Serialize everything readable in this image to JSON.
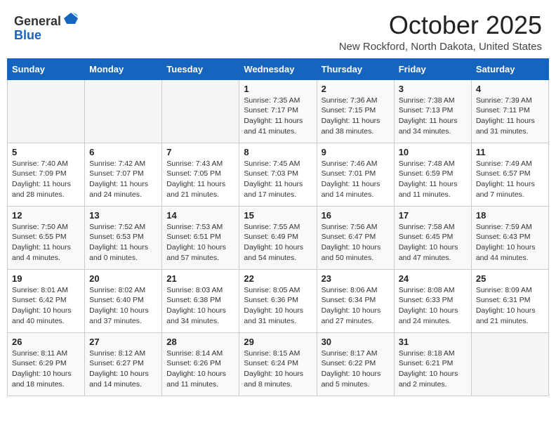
{
  "header": {
    "logo_line1": "General",
    "logo_line2": "Blue",
    "month": "October 2025",
    "location": "New Rockford, North Dakota, United States"
  },
  "weekdays": [
    "Sunday",
    "Monday",
    "Tuesday",
    "Wednesday",
    "Thursday",
    "Friday",
    "Saturday"
  ],
  "weeks": [
    [
      {
        "day": "",
        "sunrise": "",
        "sunset": "",
        "daylight": ""
      },
      {
        "day": "",
        "sunrise": "",
        "sunset": "",
        "daylight": ""
      },
      {
        "day": "",
        "sunrise": "",
        "sunset": "",
        "daylight": ""
      },
      {
        "day": "1",
        "sunrise": "Sunrise: 7:35 AM",
        "sunset": "Sunset: 7:17 PM",
        "daylight": "Daylight: 11 hours and 41 minutes."
      },
      {
        "day": "2",
        "sunrise": "Sunrise: 7:36 AM",
        "sunset": "Sunset: 7:15 PM",
        "daylight": "Daylight: 11 hours and 38 minutes."
      },
      {
        "day": "3",
        "sunrise": "Sunrise: 7:38 AM",
        "sunset": "Sunset: 7:13 PM",
        "daylight": "Daylight: 11 hours and 34 minutes."
      },
      {
        "day": "4",
        "sunrise": "Sunrise: 7:39 AM",
        "sunset": "Sunset: 7:11 PM",
        "daylight": "Daylight: 11 hours and 31 minutes."
      }
    ],
    [
      {
        "day": "5",
        "sunrise": "Sunrise: 7:40 AM",
        "sunset": "Sunset: 7:09 PM",
        "daylight": "Daylight: 11 hours and 28 minutes."
      },
      {
        "day": "6",
        "sunrise": "Sunrise: 7:42 AM",
        "sunset": "Sunset: 7:07 PM",
        "daylight": "Daylight: 11 hours and 24 minutes."
      },
      {
        "day": "7",
        "sunrise": "Sunrise: 7:43 AM",
        "sunset": "Sunset: 7:05 PM",
        "daylight": "Daylight: 11 hours and 21 minutes."
      },
      {
        "day": "8",
        "sunrise": "Sunrise: 7:45 AM",
        "sunset": "Sunset: 7:03 PM",
        "daylight": "Daylight: 11 hours and 17 minutes."
      },
      {
        "day": "9",
        "sunrise": "Sunrise: 7:46 AM",
        "sunset": "Sunset: 7:01 PM",
        "daylight": "Daylight: 11 hours and 14 minutes."
      },
      {
        "day": "10",
        "sunrise": "Sunrise: 7:48 AM",
        "sunset": "Sunset: 6:59 PM",
        "daylight": "Daylight: 11 hours and 11 minutes."
      },
      {
        "day": "11",
        "sunrise": "Sunrise: 7:49 AM",
        "sunset": "Sunset: 6:57 PM",
        "daylight": "Daylight: 11 hours and 7 minutes."
      }
    ],
    [
      {
        "day": "12",
        "sunrise": "Sunrise: 7:50 AM",
        "sunset": "Sunset: 6:55 PM",
        "daylight": "Daylight: 11 hours and 4 minutes."
      },
      {
        "day": "13",
        "sunrise": "Sunrise: 7:52 AM",
        "sunset": "Sunset: 6:53 PM",
        "daylight": "Daylight: 11 hours and 0 minutes."
      },
      {
        "day": "14",
        "sunrise": "Sunrise: 7:53 AM",
        "sunset": "Sunset: 6:51 PM",
        "daylight": "Daylight: 10 hours and 57 minutes."
      },
      {
        "day": "15",
        "sunrise": "Sunrise: 7:55 AM",
        "sunset": "Sunset: 6:49 PM",
        "daylight": "Daylight: 10 hours and 54 minutes."
      },
      {
        "day": "16",
        "sunrise": "Sunrise: 7:56 AM",
        "sunset": "Sunset: 6:47 PM",
        "daylight": "Daylight: 10 hours and 50 minutes."
      },
      {
        "day": "17",
        "sunrise": "Sunrise: 7:58 AM",
        "sunset": "Sunset: 6:45 PM",
        "daylight": "Daylight: 10 hours and 47 minutes."
      },
      {
        "day": "18",
        "sunrise": "Sunrise: 7:59 AM",
        "sunset": "Sunset: 6:43 PM",
        "daylight": "Daylight: 10 hours and 44 minutes."
      }
    ],
    [
      {
        "day": "19",
        "sunrise": "Sunrise: 8:01 AM",
        "sunset": "Sunset: 6:42 PM",
        "daylight": "Daylight: 10 hours and 40 minutes."
      },
      {
        "day": "20",
        "sunrise": "Sunrise: 8:02 AM",
        "sunset": "Sunset: 6:40 PM",
        "daylight": "Daylight: 10 hours and 37 minutes."
      },
      {
        "day": "21",
        "sunrise": "Sunrise: 8:03 AM",
        "sunset": "Sunset: 6:38 PM",
        "daylight": "Daylight: 10 hours and 34 minutes."
      },
      {
        "day": "22",
        "sunrise": "Sunrise: 8:05 AM",
        "sunset": "Sunset: 6:36 PM",
        "daylight": "Daylight: 10 hours and 31 minutes."
      },
      {
        "day": "23",
        "sunrise": "Sunrise: 8:06 AM",
        "sunset": "Sunset: 6:34 PM",
        "daylight": "Daylight: 10 hours and 27 minutes."
      },
      {
        "day": "24",
        "sunrise": "Sunrise: 8:08 AM",
        "sunset": "Sunset: 6:33 PM",
        "daylight": "Daylight: 10 hours and 24 minutes."
      },
      {
        "day": "25",
        "sunrise": "Sunrise: 8:09 AM",
        "sunset": "Sunset: 6:31 PM",
        "daylight": "Daylight: 10 hours and 21 minutes."
      }
    ],
    [
      {
        "day": "26",
        "sunrise": "Sunrise: 8:11 AM",
        "sunset": "Sunset: 6:29 PM",
        "daylight": "Daylight: 10 hours and 18 minutes."
      },
      {
        "day": "27",
        "sunrise": "Sunrise: 8:12 AM",
        "sunset": "Sunset: 6:27 PM",
        "daylight": "Daylight: 10 hours and 14 minutes."
      },
      {
        "day": "28",
        "sunrise": "Sunrise: 8:14 AM",
        "sunset": "Sunset: 6:26 PM",
        "daylight": "Daylight: 10 hours and 11 minutes."
      },
      {
        "day": "29",
        "sunrise": "Sunrise: 8:15 AM",
        "sunset": "Sunset: 6:24 PM",
        "daylight": "Daylight: 10 hours and 8 minutes."
      },
      {
        "day": "30",
        "sunrise": "Sunrise: 8:17 AM",
        "sunset": "Sunset: 6:22 PM",
        "daylight": "Daylight: 10 hours and 5 minutes."
      },
      {
        "day": "31",
        "sunrise": "Sunrise: 8:18 AM",
        "sunset": "Sunset: 6:21 PM",
        "daylight": "Daylight: 10 hours and 2 minutes."
      },
      {
        "day": "",
        "sunrise": "",
        "sunset": "",
        "daylight": ""
      }
    ]
  ]
}
